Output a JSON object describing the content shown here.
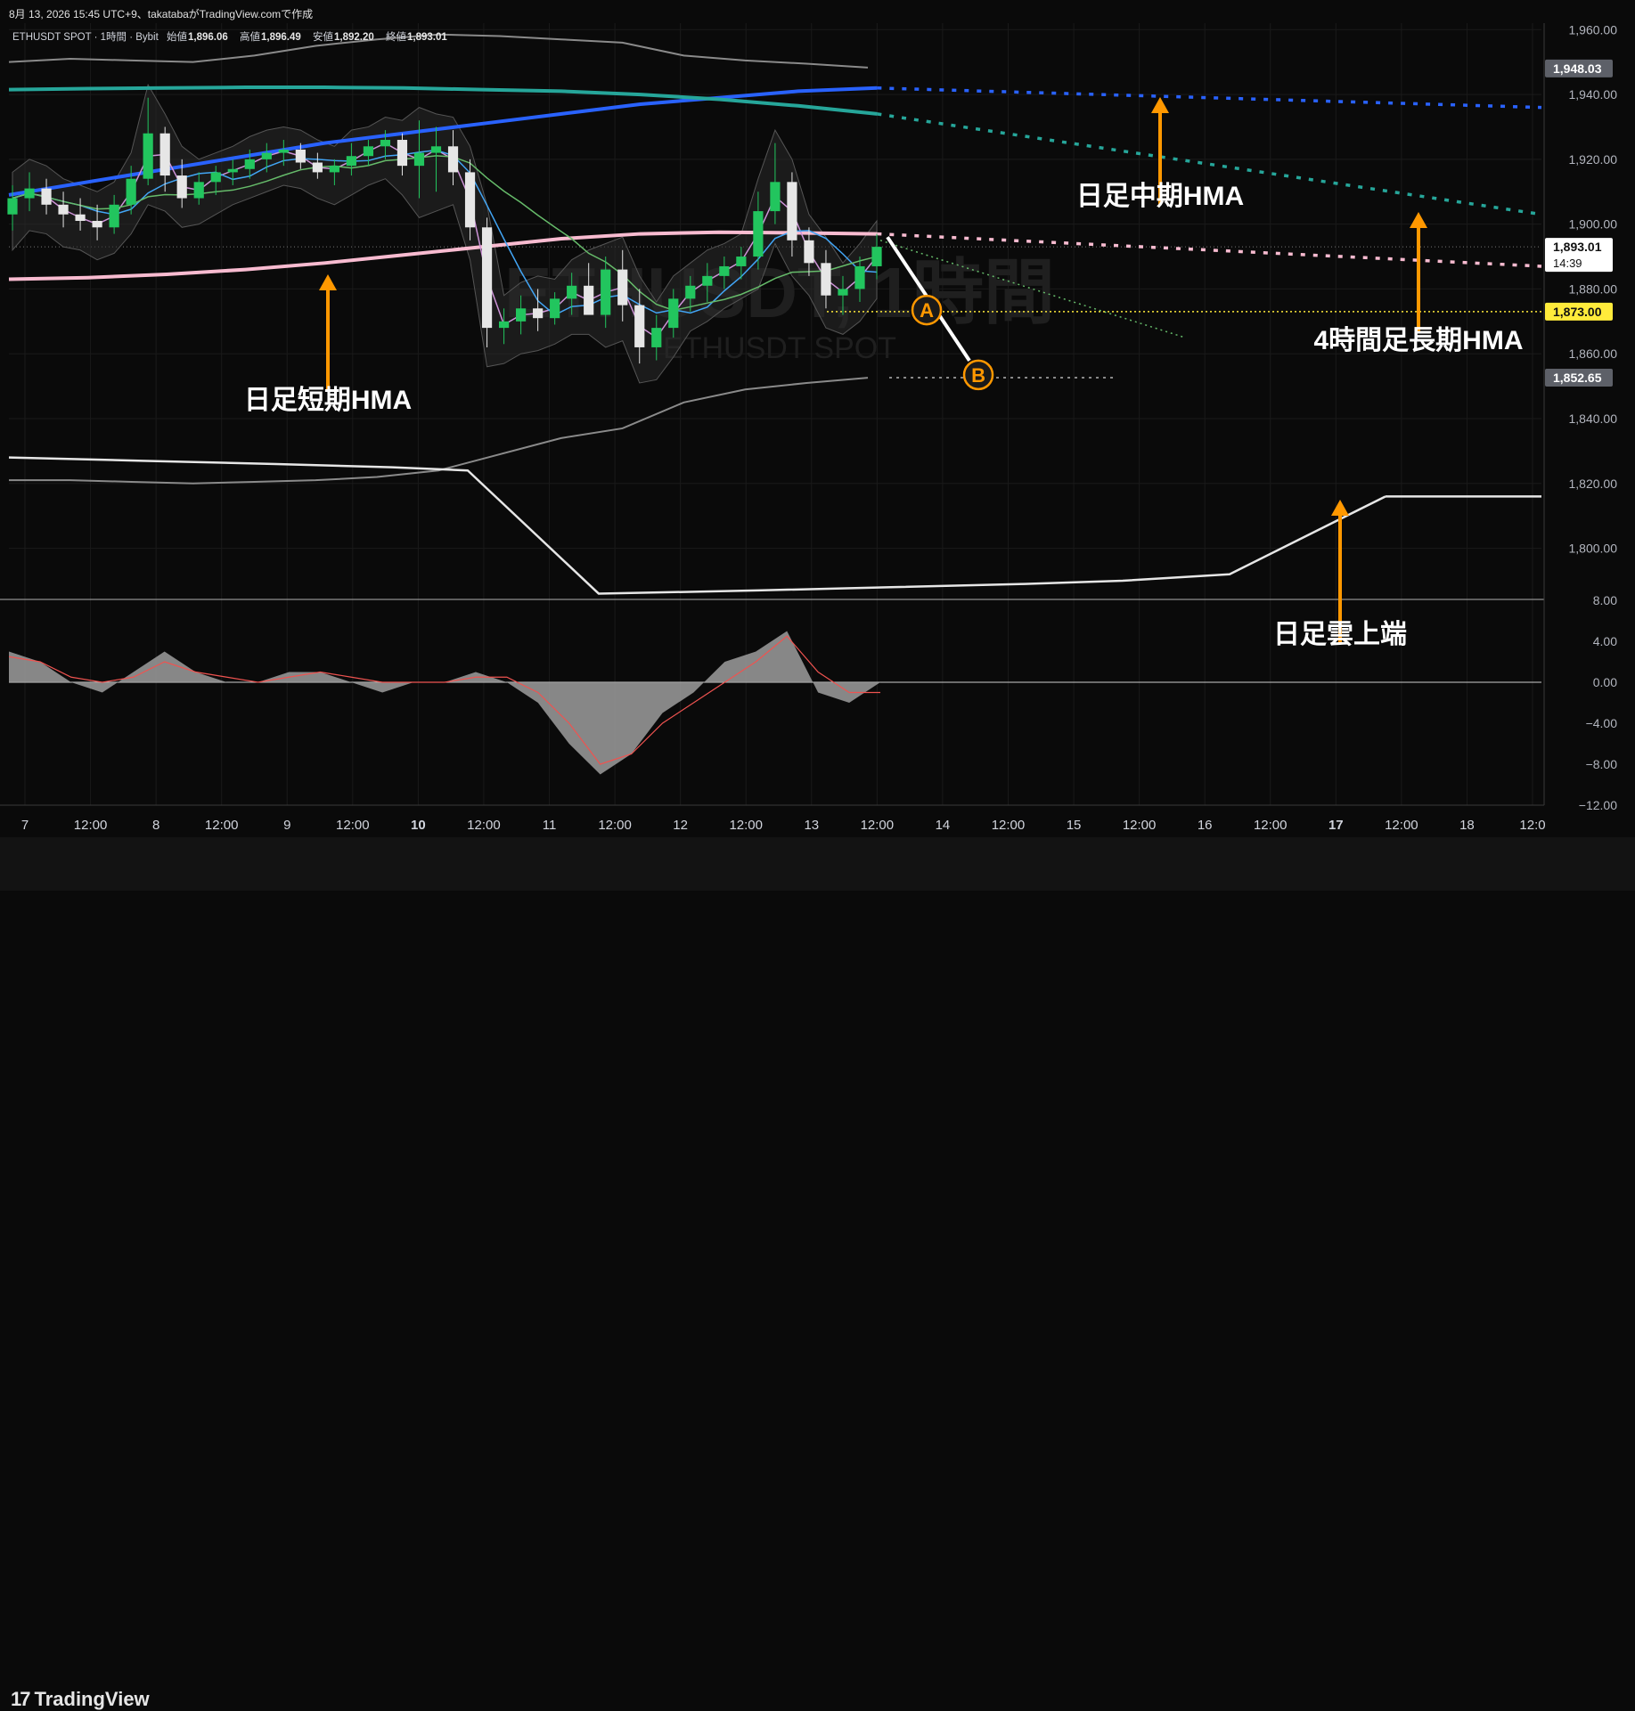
{
  "header": {
    "timestamp": "8月 13, 2026 15:45 UTC+9、takatabaがTradingView.comで作成",
    "symbol_line": "ETHUSDT SPOT · 1時間 · Bybit",
    "ohlc": [
      {
        "label": "始値",
        "value": "1,896.06"
      },
      {
        "label": "高値",
        "value": "1,896.49"
      },
      {
        "label": "安値",
        "value": "1,892.20"
      },
      {
        "label": "終値",
        "value": "1,893.01"
      }
    ]
  },
  "watermark": {
    "line1": "ETHUSDT, 1時間",
    "line2": "ETHUSDT SPOT"
  },
  "footer": {
    "logo_text": "TradingView"
  },
  "colors": {
    "bg": "#0a0a0a",
    "grid": "#1a1a1a",
    "up": "#22c55e",
    "down": "#e6e6e6",
    "blue_hma": "#2962ff",
    "teal_hma": "#26a69a",
    "pink_hma": "#f8bbd0",
    "annotation": "#ff9800",
    "price_now": "#ffffff",
    "level_yellow": "#ffeb3b"
  },
  "chart_data": [
    {
      "type": "candlestick",
      "title": "",
      "x_ticks": [
        "7",
        "12:00",
        "8",
        "12:00",
        "9",
        "12:00",
        "10",
        "12:00",
        "11",
        "12:00",
        "12",
        "12:00",
        "13",
        "12:00",
        "14",
        "12:00",
        "15",
        "12:00",
        "16",
        "12:00",
        "17",
        "12:00",
        "18",
        "12:0"
      ],
      "x_ticks_bold": [
        "10",
        "17"
      ],
      "x_index_range": [
        0,
        23
      ],
      "y_ticks": [
        "1,960.00",
        "1,940.00",
        "1,920.00",
        "1,900.00",
        "1,880.00",
        "1,860.00",
        "1,840.00",
        "1,820.00",
        "1,800.00"
      ],
      "ylim": [
        1784.5,
        1962
      ],
      "price_labels": [
        {
          "value": 1948.03,
          "text": "1,948.03",
          "bg": "#5d6068",
          "fg": "#ffffff"
        },
        {
          "value": 1893.01,
          "text": "1,893.01",
          "sub": "14:39",
          "bg": "#ffffff",
          "fg": "#111111"
        },
        {
          "value": 1873.0,
          "text": "1,873.00",
          "bg": "#ffeb3b",
          "fg": "#111111"
        },
        {
          "value": 1852.65,
          "text": "1,852.65",
          "bg": "#5d6068",
          "fg": "#ffffff"
        }
      ],
      "ohlc_series": [
        [
          1903,
          1912,
          1898,
          1908
        ],
        [
          1908,
          1916,
          1904,
          1911
        ],
        [
          1911,
          1914,
          1903,
          1906
        ],
        [
          1906,
          1910,
          1899,
          1903
        ],
        [
          1903,
          1908,
          1898,
          1901
        ],
        [
          1901,
          1906,
          1895,
          1899
        ],
        [
          1899,
          1909,
          1897,
          1906
        ],
        [
          1906,
          1918,
          1903,
          1914
        ],
        [
          1914,
          1939,
          1912,
          1928
        ],
        [
          1928,
          1930,
          1910,
          1915
        ],
        [
          1915,
          1920,
          1905,
          1908
        ],
        [
          1908,
          1916,
          1906,
          1913
        ],
        [
          1913,
          1918,
          1909,
          1916
        ],
        [
          1916,
          1920,
          1912,
          1917
        ],
        [
          1917,
          1923,
          1914,
          1920
        ],
        [
          1920,
          1925,
          1916,
          1922
        ],
        [
          1922,
          1926,
          1918,
          1923
        ],
        [
          1923,
          1925,
          1917,
          1919
        ],
        [
          1919,
          1922,
          1914,
          1916
        ],
        [
          1916,
          1920,
          1912,
          1918
        ],
        [
          1918,
          1925,
          1915,
          1921
        ],
        [
          1921,
          1926,
          1918,
          1924
        ],
        [
          1924,
          1929,
          1920,
          1926
        ],
        [
          1926,
          1928,
          1915,
          1918
        ],
        [
          1918,
          1932,
          1908,
          1922
        ],
        [
          1922,
          1930,
          1910,
          1924
        ],
        [
          1924,
          1929,
          1912,
          1916
        ],
        [
          1916,
          1920,
          1895,
          1899
        ],
        [
          1899,
          1902,
          1862,
          1868
        ],
        [
          1868,
          1874,
          1863,
          1870
        ],
        [
          1870,
          1878,
          1866,
          1874
        ],
        [
          1874,
          1880,
          1867,
          1871
        ],
        [
          1871,
          1879,
          1869,
          1877
        ],
        [
          1877,
          1885,
          1872,
          1881
        ],
        [
          1881,
          1888,
          1876,
          1872
        ],
        [
          1872,
          1890,
          1868,
          1886
        ],
        [
          1886,
          1892,
          1870,
          1875
        ],
        [
          1875,
          1880,
          1857,
          1862
        ],
        [
          1862,
          1872,
          1858,
          1868
        ],
        [
          1868,
          1880,
          1865,
          1877
        ],
        [
          1877,
          1884,
          1873,
          1881
        ],
        [
          1881,
          1888,
          1876,
          1884
        ],
        [
          1884,
          1890,
          1880,
          1887
        ],
        [
          1887,
          1893,
          1883,
          1890
        ],
        [
          1890,
          1910,
          1886,
          1904
        ],
        [
          1904,
          1925,
          1900,
          1913
        ],
        [
          1913,
          1916,
          1890,
          1895
        ],
        [
          1895,
          1899,
          1884,
          1888
        ],
        [
          1888,
          1892,
          1874,
          1878
        ],
        [
          1878,
          1884,
          1872,
          1880
        ],
        [
          1880,
          1890,
          1876,
          1887
        ],
        [
          1887,
          1897,
          1883,
          1893
        ]
      ],
      "series": [
        {
          "name": "日足中期HMA",
          "color": "#2962ff",
          "values": [
            1909,
            1913,
            1917,
            1921,
            1925,
            1928,
            1931,
            1934,
            1937,
            1939,
            1941,
            1942
          ]
        },
        {
          "name": "4時間足長期HMA",
          "color": "#26a69a",
          "values": [
            1941.5,
            1941.8,
            1942,
            1942.2,
            1942.2,
            1942,
            1941.5,
            1941,
            1940,
            1938.5,
            1936.5,
            1934
          ]
        },
        {
          "name": "日足短期HMA",
          "color": "#f8bbd0",
          "values": [
            1883,
            1883.5,
            1884.5,
            1886,
            1888,
            1890.5,
            1893,
            1895.5,
            1897,
            1897.5,
            1897.3,
            1897
          ]
        },
        {
          "name": "日足雲上端",
          "color": "#e6e6e6",
          "values": [
            1828,
            1827,
            1826,
            1825,
            1824,
            1786,
            1787,
            1788,
            1789,
            1790,
            1792,
            1816
          ]
        }
      ],
      "projections": [
        {
          "name": "日足中期HMA",
          "color": "#2962ff",
          "from": 1942,
          "to": 1936
        },
        {
          "name": "4時間足長期HMA",
          "color": "#26a69a",
          "from": 1934,
          "to": 1903
        },
        {
          "name": "日足短期HMA",
          "color": "#f8bbd0",
          "from": 1897,
          "to": 1887
        }
      ],
      "level_line": 1873.0,
      "points": [
        {
          "label": "A",
          "value": 1873.5
        },
        {
          "label": "B",
          "value": 1853.5
        }
      ]
    },
    {
      "type": "area",
      "title": "",
      "y_ticks": [
        "8.00",
        "4.00",
        "0.00",
        "−4.00",
        "−8.00",
        "−12.00"
      ],
      "ylim": [
        -12,
        8
      ],
      "series": [
        {
          "name": "",
          "color": "#9e9e9e",
          "values": [
            3,
            2,
            0,
            -1,
            1,
            3,
            1,
            0,
            0,
            1,
            1,
            0,
            -1,
            0,
            0,
            1,
            0,
            -2,
            -6,
            -9,
            -7,
            -3,
            -1,
            2,
            3,
            5,
            -1,
            -2,
            0
          ]
        },
        {
          "name": "",
          "color": "#ef5350",
          "values": [
            2.5,
            2,
            0.5,
            0,
            0.5,
            2,
            1,
            0.5,
            0,
            0.5,
            1,
            0.5,
            0,
            0,
            0,
            0.5,
            0.5,
            -1,
            -4,
            -8,
            -7,
            -4,
            -2,
            0,
            2,
            4.5,
            1,
            -1,
            -1
          ]
        }
      ]
    }
  ],
  "annotations": [
    {
      "text": "日足中期HMA"
    },
    {
      "text": "4時間足長期HMA"
    },
    {
      "text": "日足短期HMA"
    },
    {
      "text": "日足雲上端"
    }
  ]
}
